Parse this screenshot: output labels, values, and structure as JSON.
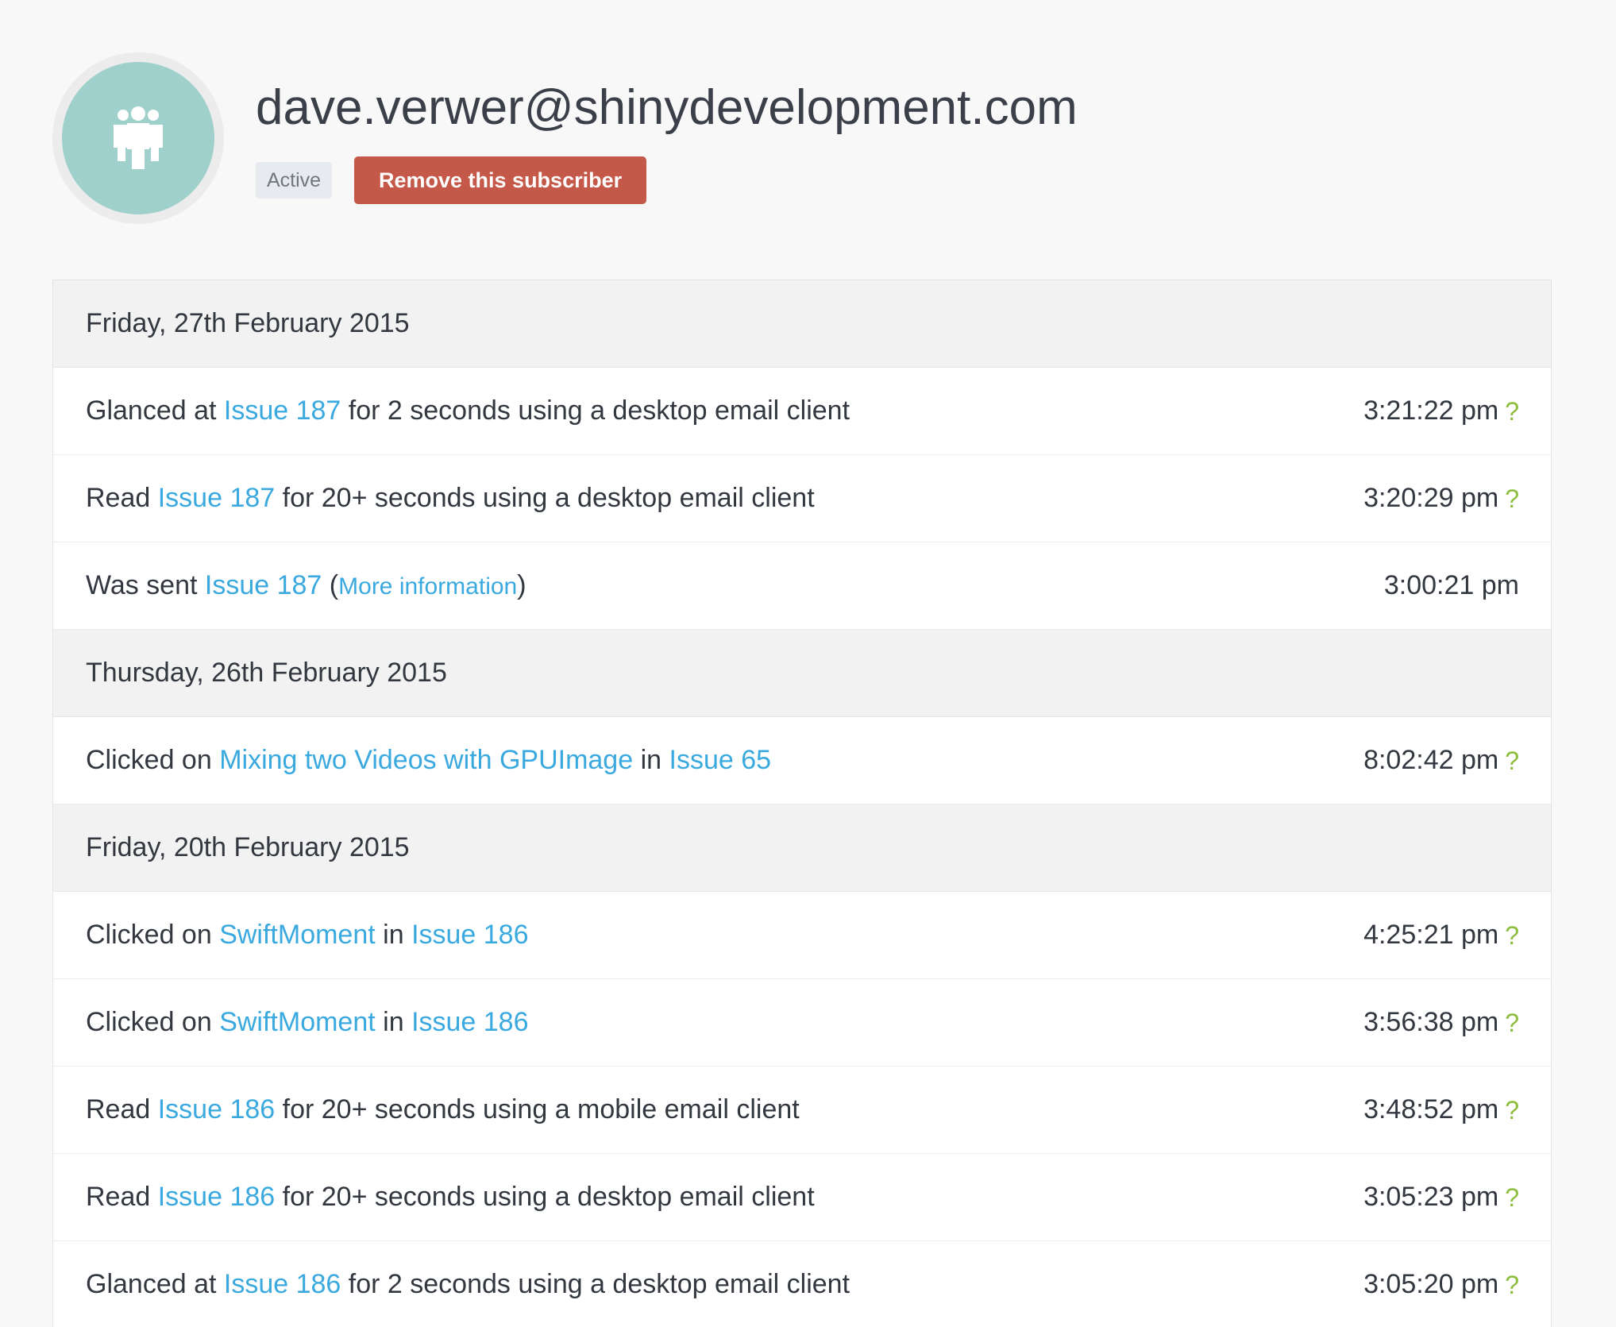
{
  "subscriber": {
    "email": "dave.verwer@shinydevelopment.com",
    "status": "Active",
    "remove_label": "Remove this subscriber",
    "avatar_icon": "group-user-icon"
  },
  "colors": {
    "background": "#f8f8f8",
    "avatar_bg": "#9fd0cb",
    "link": "#39a9df",
    "remove_button": "#c55949",
    "help_icon": "#8cbd3f",
    "date_row_bg": "#f2f2f2"
  },
  "activity": [
    {
      "date": "Friday, 27th February 2015",
      "entries": [
        {
          "parts": [
            {
              "text": "Glanced at "
            },
            {
              "text": "Issue 187",
              "link": true
            },
            {
              "text": " for 2 seconds using a desktop email client"
            }
          ],
          "time": "3:21:22 pm",
          "help": "?"
        },
        {
          "parts": [
            {
              "text": "Read "
            },
            {
              "text": "Issue 187",
              "link": true
            },
            {
              "text": " for 20+ seconds using a desktop email client"
            }
          ],
          "time": "3:20:29 pm",
          "help": "?"
        },
        {
          "parts": [
            {
              "text": "Was sent "
            },
            {
              "text": "Issue 187",
              "link": true
            },
            {
              "text": " ("
            },
            {
              "text": "More information",
              "link": true,
              "small": true
            },
            {
              "text": ")"
            }
          ],
          "time": "3:00:21 pm",
          "help": ""
        }
      ]
    },
    {
      "date": "Thursday, 26th February 2015",
      "entries": [
        {
          "parts": [
            {
              "text": "Clicked on "
            },
            {
              "text": "Mixing two Videos with GPUImage",
              "link": true
            },
            {
              "text": " in "
            },
            {
              "text": "Issue 65",
              "link": true
            }
          ],
          "time": "8:02:42 pm",
          "help": "?"
        }
      ]
    },
    {
      "date": "Friday, 20th February 2015",
      "entries": [
        {
          "parts": [
            {
              "text": "Clicked on "
            },
            {
              "text": "SwiftMoment",
              "link": true
            },
            {
              "text": " in "
            },
            {
              "text": "Issue 186",
              "link": true
            }
          ],
          "time": "4:25:21 pm",
          "help": "?"
        },
        {
          "parts": [
            {
              "text": "Clicked on "
            },
            {
              "text": "SwiftMoment",
              "link": true
            },
            {
              "text": " in "
            },
            {
              "text": "Issue 186",
              "link": true
            }
          ],
          "time": "3:56:38 pm",
          "help": "?"
        },
        {
          "parts": [
            {
              "text": "Read "
            },
            {
              "text": "Issue 186",
              "link": true
            },
            {
              "text": " for 20+ seconds using a mobile email client"
            }
          ],
          "time": "3:48:52 pm",
          "help": "?"
        },
        {
          "parts": [
            {
              "text": "Read "
            },
            {
              "text": "Issue 186",
              "link": true
            },
            {
              "text": " for 20+ seconds using a desktop email client"
            }
          ],
          "time": "3:05:23 pm",
          "help": "?"
        },
        {
          "parts": [
            {
              "text": "Glanced at "
            },
            {
              "text": "Issue 186",
              "link": true
            },
            {
              "text": " for 2 seconds using a desktop email client"
            }
          ],
          "time": "3:05:20 pm",
          "help": "?"
        }
      ]
    }
  ]
}
